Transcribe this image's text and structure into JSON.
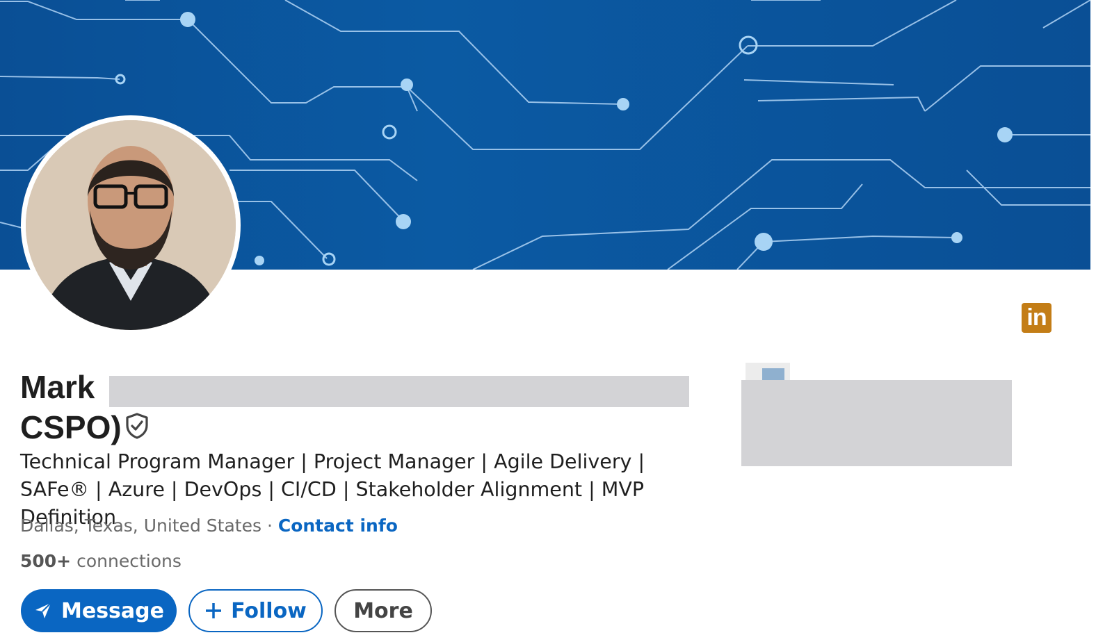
{
  "profile": {
    "name_line1": "Mark",
    "name_line2": "CSPO)",
    "headline": "Technical Program Manager | Project Manager | Agile Delivery | SAFe® | Azure | DevOps | CI/CD | Stakeholder Alignment | MVP Definition",
    "location": "Dallas, Texas, United States",
    "separator": " · ",
    "contact_info": "Contact info",
    "connections_count": "500+",
    "connections_label": " connections"
  },
  "actions": {
    "message": "Message",
    "follow": "Follow",
    "more": "More"
  },
  "brand": {
    "badge_text": "in",
    "accent": "#0a66c2",
    "badge_color": "#c37d16",
    "banner_color": "#0b5aa3"
  },
  "icons": {
    "verified": "shield-check-icon",
    "message": "send-icon",
    "follow": "plus-icon",
    "linkedin": "linkedin-icon"
  }
}
